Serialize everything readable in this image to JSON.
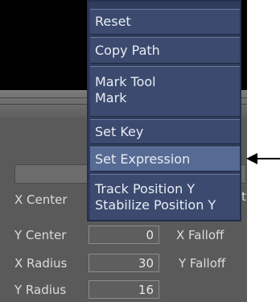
{
  "context_menu": {
    "items": [
      {
        "label": "Reset"
      },
      {
        "label": "Copy Path"
      },
      {
        "lines": [
          "Mark Tool",
          "Mark"
        ]
      },
      {
        "label": "Set Key"
      },
      {
        "label": "Set Expression",
        "highlighted": true
      },
      {
        "lines": [
          "Track Position Y",
          "Stabilize Position Y"
        ]
      }
    ]
  },
  "params": {
    "x_center_label": "X Center",
    "y_center_label": "Y Center",
    "y_center_value": "0",
    "x_falloff_label": "X Falloff",
    "x_radius_label": "X Radius",
    "x_radius_value": "30",
    "y_falloff_label": "Y Falloff",
    "y_radius_label": "Y Radius",
    "y_radius_value": "16",
    "clipped_char": "t"
  },
  "colors": {
    "menu_bg": "#3b4a6e",
    "menu_highlight": "#566a93",
    "panel_bg": "#5a5a5a"
  },
  "annotation": {
    "arrow_icon": "left-arrow-icon"
  }
}
